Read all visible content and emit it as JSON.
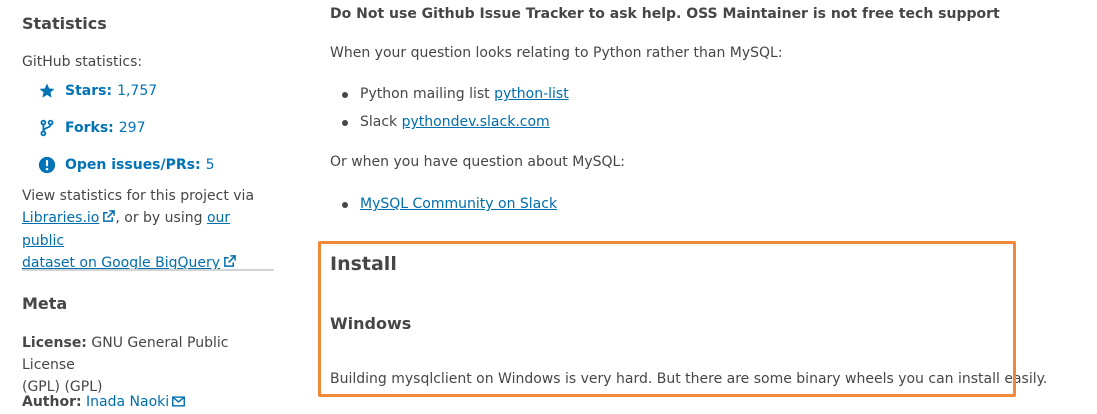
{
  "sidebar": {
    "statistics_heading": "Statistics",
    "github_label": "GitHub statistics:",
    "stats": [
      {
        "label": "Stars:",
        "value": "1,757",
        "icon": "star-icon"
      },
      {
        "label": "Forks:",
        "value": "297",
        "icon": "fork-icon"
      },
      {
        "label": "Open issues/PRs:",
        "value": "5",
        "icon": "alert-circle-icon"
      }
    ],
    "view_stats_prefix": "View statistics for this project via",
    "libraries_link": "Libraries.io",
    "or_by_using": ", or by using",
    "our_public": "our public",
    "bigquery_link": "dataset on Google BigQuery",
    "meta_heading": "Meta",
    "license_label": "License:",
    "license_value_1": "GNU General Public License",
    "license_value_2": "(GPL) (GPL)",
    "author_label": "Author:",
    "author_value": "Inada Naoki"
  },
  "main": {
    "warning": "Do Not use Github Issue Tracker to ask help. OSS Maintainer is not free tech support",
    "python_intro": "When your question looks relating to Python rather than MySQL:",
    "python_items": [
      {
        "prefix": "Python mailing list ",
        "link": "python-list"
      },
      {
        "prefix": "Slack ",
        "link": "pythondev.slack.com"
      }
    ],
    "mysql_intro": "Or when you have question about MySQL:",
    "mysql_link": "MySQL Community on Slack",
    "install_heading": "Install",
    "windows_heading": "Windows",
    "windows_text": "Building mysqlclient on Windows is very hard. But there are some binary wheels you can install easily."
  },
  "colors": {
    "link": "#006dad",
    "stat_blue": "#0073b7",
    "highlight": "#f0883a",
    "text": "#464646"
  }
}
